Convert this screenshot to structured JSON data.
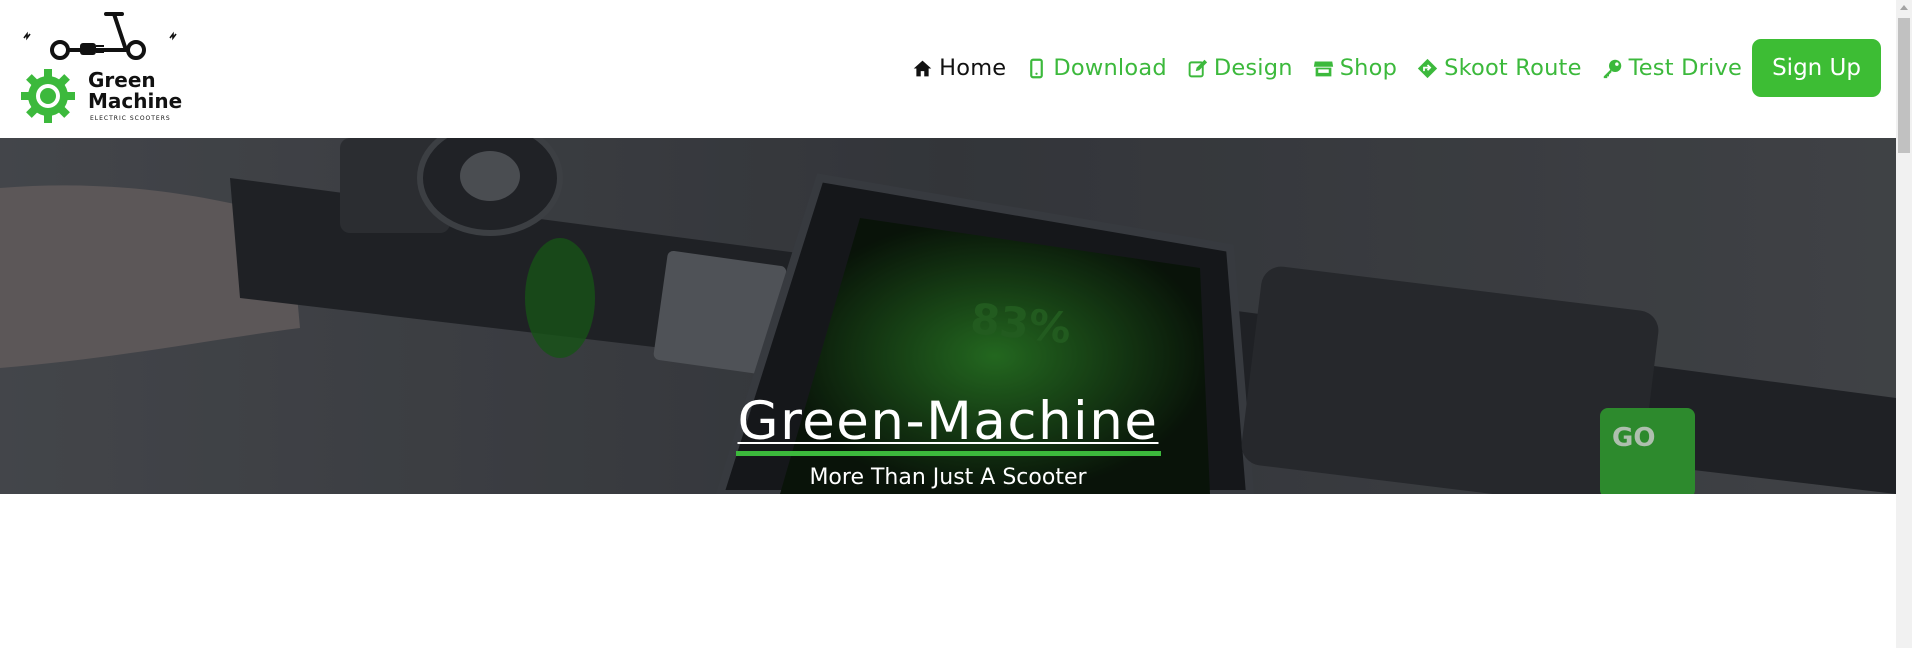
{
  "brand": {
    "line1": "Green",
    "line2": "Machine",
    "tagline": "ELECTRIC SCOOTERS",
    "color": "#3cb93c"
  },
  "nav": [
    {
      "label": "Home",
      "icon": "home-icon",
      "active": true
    },
    {
      "label": "Download",
      "icon": "mobile-icon",
      "active": false
    },
    {
      "label": "Design",
      "icon": "edit-icon",
      "active": false
    },
    {
      "label": "Shop",
      "icon": "store-icon",
      "active": false
    },
    {
      "label": "Skoot Route",
      "icon": "route-icon",
      "active": false
    },
    {
      "label": "Test Drive",
      "icon": "key-icon",
      "active": false
    }
  ],
  "signup": {
    "label": "Sign Up",
    "color": "#3dbd34"
  },
  "hero": {
    "display_battery": "83%",
    "go_button": "GO",
    "title": "Green-Machine",
    "subtitle": "More Than Just A Scooter"
  }
}
